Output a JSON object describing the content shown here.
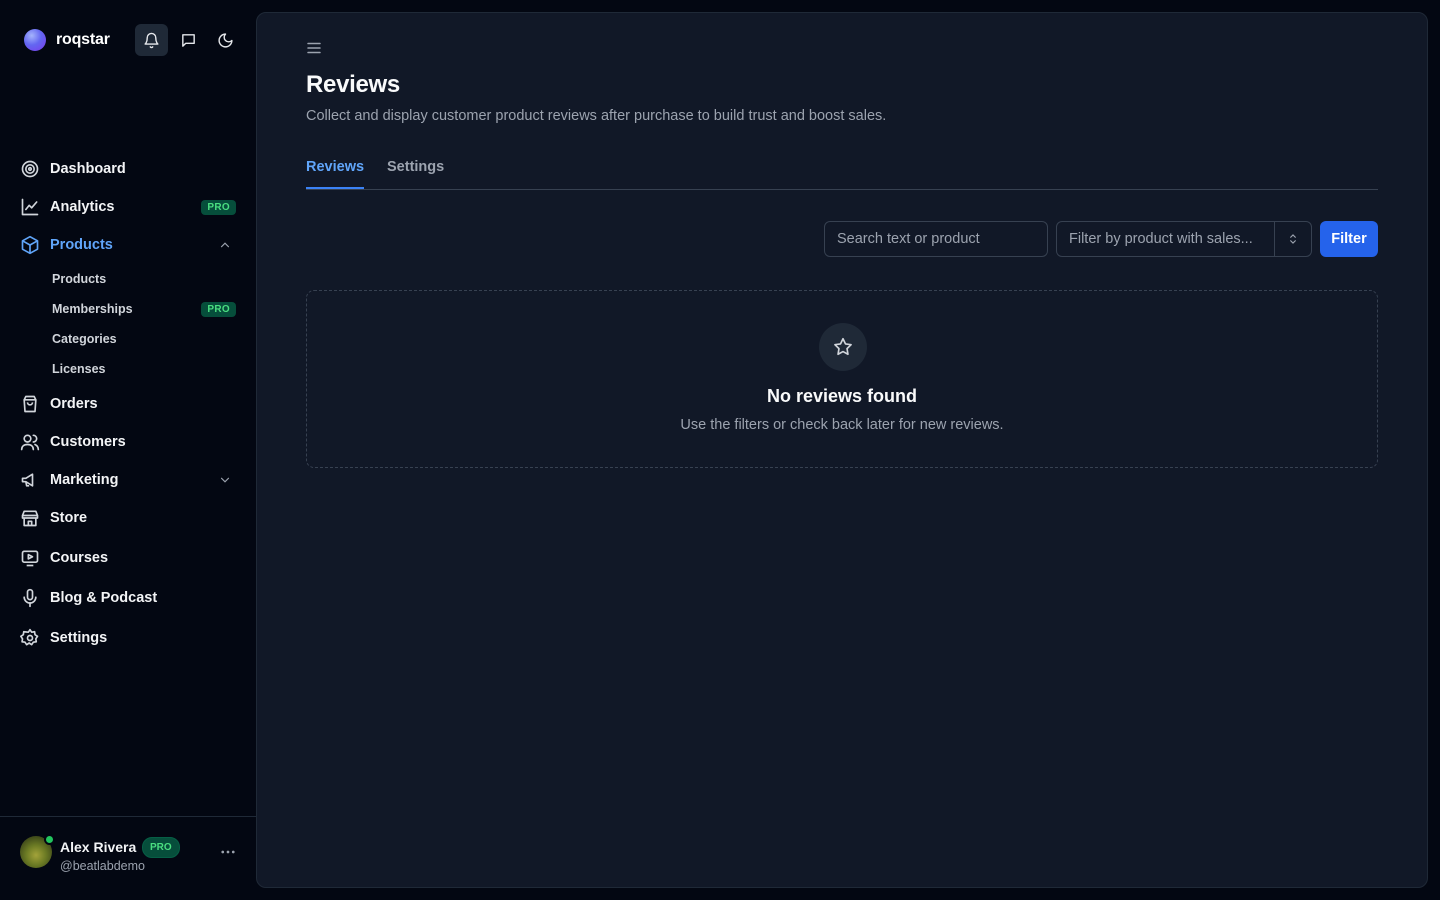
{
  "brand": {
    "name": "roqstar"
  },
  "header_icons": [
    "bell-icon",
    "chat-icon",
    "moon-icon"
  ],
  "sidebar": {
    "items": [
      {
        "label": "Dashboard",
        "icon": "target-icon"
      },
      {
        "label": "Analytics",
        "icon": "chart-icon",
        "badge": "PRO"
      },
      {
        "label": "Products",
        "icon": "box-icon",
        "active": true,
        "expanded": true
      },
      {
        "label": "Orders",
        "icon": "shopping-bag-icon"
      },
      {
        "label": "Customers",
        "icon": "users-icon"
      },
      {
        "label": "Marketing",
        "icon": "megaphone-icon",
        "collapsed": true
      },
      {
        "label": "Store",
        "icon": "store-icon"
      },
      {
        "label": "Courses",
        "icon": "video-icon"
      },
      {
        "label": "Blog & Podcast",
        "icon": "mic-icon"
      },
      {
        "label": "Settings",
        "icon": "gear-icon"
      }
    ],
    "product_subitems": [
      {
        "label": "Products"
      },
      {
        "label": "Memberships",
        "badge": "PRO"
      },
      {
        "label": "Categories"
      },
      {
        "label": "Licenses"
      }
    ]
  },
  "user": {
    "name": "Alex Rivera",
    "badge": "PRO",
    "handle": "@beatlabdemo"
  },
  "page": {
    "title": "Reviews",
    "description": "Collect and display customer product reviews after purchase to build trust and boost sales."
  },
  "tabs": [
    {
      "label": "Reviews",
      "active": true
    },
    {
      "label": "Settings",
      "active": false
    }
  ],
  "filters": {
    "search_placeholder": "Search text or product",
    "select_value": "Filter by product with sales...",
    "filter_button": "Filter"
  },
  "empty_state": {
    "icon": "star-icon",
    "title": "No reviews found",
    "subtitle": "Use the filters or check back later for new reviews."
  },
  "colors": {
    "accent": "#2563eb",
    "active_link": "#60a5fa",
    "pro_badge_text": "#4ade80",
    "online": "#22c55e"
  }
}
